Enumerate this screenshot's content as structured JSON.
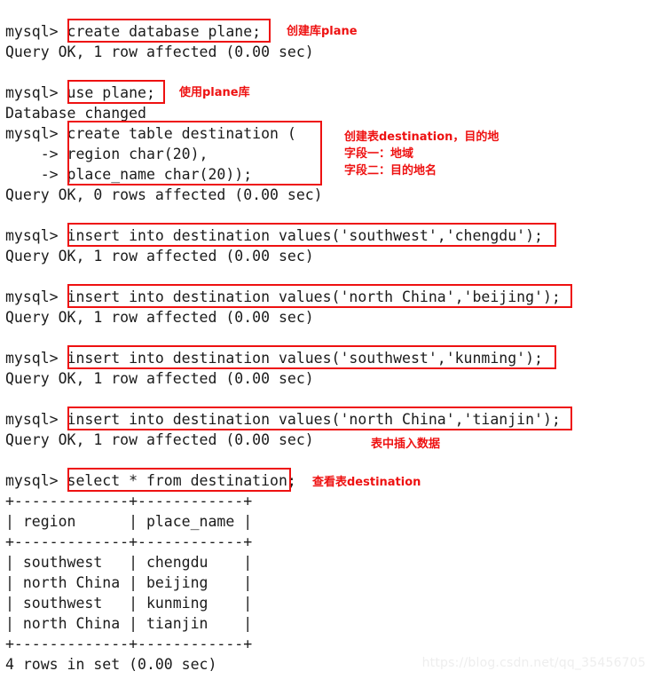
{
  "terminal": {
    "prompt": "mysql>",
    "continuation_prompt": "->",
    "lines": [
      {
        "id": "l1",
        "text": "mysql> create database plane;"
      },
      {
        "id": "l2",
        "text": "Query OK, 1 row affected (0.00 sec)"
      },
      {
        "id": "l3",
        "text": "mysql> use plane;"
      },
      {
        "id": "l4",
        "text": "Database changed"
      },
      {
        "id": "l5",
        "text": "mysql> create table destination ("
      },
      {
        "id": "l6",
        "text": "    -> region char(20),"
      },
      {
        "id": "l7",
        "text": "    -> place_name char(20));"
      },
      {
        "id": "l8",
        "text": "Query OK, 0 rows affected (0.00 sec)"
      },
      {
        "id": "l9",
        "text": "mysql> insert into destination values('southwest','chengdu');"
      },
      {
        "id": "l10",
        "text": "Query OK, 1 row affected (0.00 sec)"
      },
      {
        "id": "l11",
        "text": "mysql> insert into destination values('north China','beijing');"
      },
      {
        "id": "l12",
        "text": "Query OK, 1 row affected (0.00 sec)"
      },
      {
        "id": "l13",
        "text": "mysql> insert into destination values('southwest','kunming');"
      },
      {
        "id": "l14",
        "text": "Query OK, 1 row affected (0.00 sec)"
      },
      {
        "id": "l15",
        "text": "mysql> insert into destination values('north China','tianjin');"
      },
      {
        "id": "l16",
        "text": "Query OK, 1 row affected (0.00 sec)"
      },
      {
        "id": "l17",
        "text": "mysql> select * from destination;"
      },
      {
        "id": "l18",
        "text": "+-------------+------------+"
      },
      {
        "id": "l19",
        "text": "| region      | place_name |"
      },
      {
        "id": "l20",
        "text": "+-------------+------------+"
      },
      {
        "id": "l21",
        "text": "| southwest   | chengdu    |"
      },
      {
        "id": "l22",
        "text": "| north China | beijing    |"
      },
      {
        "id": "l23",
        "text": "| southwest   | kunming    |"
      },
      {
        "id": "l24",
        "text": "| north China | tianjin    |"
      },
      {
        "id": "l25",
        "text": "+-------------+------------+"
      },
      {
        "id": "l26",
        "text": "4 rows in set (0.00 sec)"
      }
    ]
  },
  "result_table": {
    "columns": [
      "region",
      "place_name"
    ],
    "rows": [
      [
        "southwest",
        "chengdu"
      ],
      [
        "north China",
        "beijing"
      ],
      [
        "southwest",
        "kunming"
      ],
      [
        "north China",
        "tianjin"
      ]
    ],
    "footer": "4 rows in set (0.00 sec)"
  },
  "annotations": [
    {
      "id": "a1",
      "text": "创建库plane"
    },
    {
      "id": "a2",
      "text": "使用plane库"
    },
    {
      "id": "a3",
      "text": "创建表destination，目的地"
    },
    {
      "id": "a4",
      "text": "字段一：地域"
    },
    {
      "id": "a5",
      "text": "字段二：目的地名"
    },
    {
      "id": "a6",
      "text": "表中插入数据"
    },
    {
      "id": "a7",
      "text": "查看表destination"
    }
  ],
  "colors": {
    "highlight": "#ee1111",
    "text": "#1b1b1b",
    "background": "#ffffff",
    "watermark": "#eeeeee"
  },
  "watermark": "https://blog.csdn.net/qq_35456705"
}
